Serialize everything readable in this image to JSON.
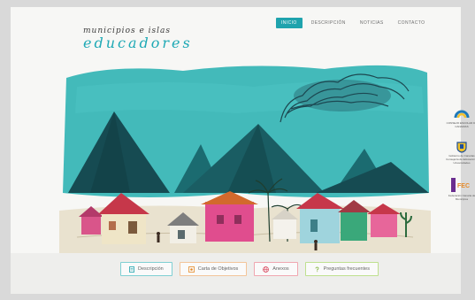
{
  "logo": {
    "line1": "municipios e islas",
    "line2": "educadores"
  },
  "nav": {
    "items": [
      {
        "label": "INICIO",
        "active": true
      },
      {
        "label": "DESCRIPCIÓN",
        "active": false
      },
      {
        "label": "NOTICIAS",
        "active": false
      },
      {
        "label": "CONTACTO",
        "active": false
      }
    ]
  },
  "sponsors": [
    {
      "label": "CONSEJO ESCOLAR DE CANARIAS",
      "icon": "arc-logo-icon"
    },
    {
      "label": "Gobierno de Canarias Consejería de Educación y Universidades",
      "icon": "crest-icon"
    },
    {
      "label": "Federación Canaria de Municipios",
      "icon": "fecam-logo-icon"
    }
  ],
  "buttons": [
    {
      "label": "Descripción",
      "icon": "document-icon",
      "color": "#7fcfd3"
    },
    {
      "label": "Carta de Objetivos",
      "icon": "target-icon",
      "color": "#f3c59a"
    },
    {
      "label": "Anexos",
      "icon": "globe-icon",
      "color": "#f0a7b0"
    },
    {
      "label": "Preguntas frecuentes",
      "icon": "question-icon",
      "color": "#bfe08f"
    }
  ],
  "colors": {
    "accent": "#1fa3ad",
    "sky": "#2fb2b4",
    "mountain": "#16535a"
  }
}
